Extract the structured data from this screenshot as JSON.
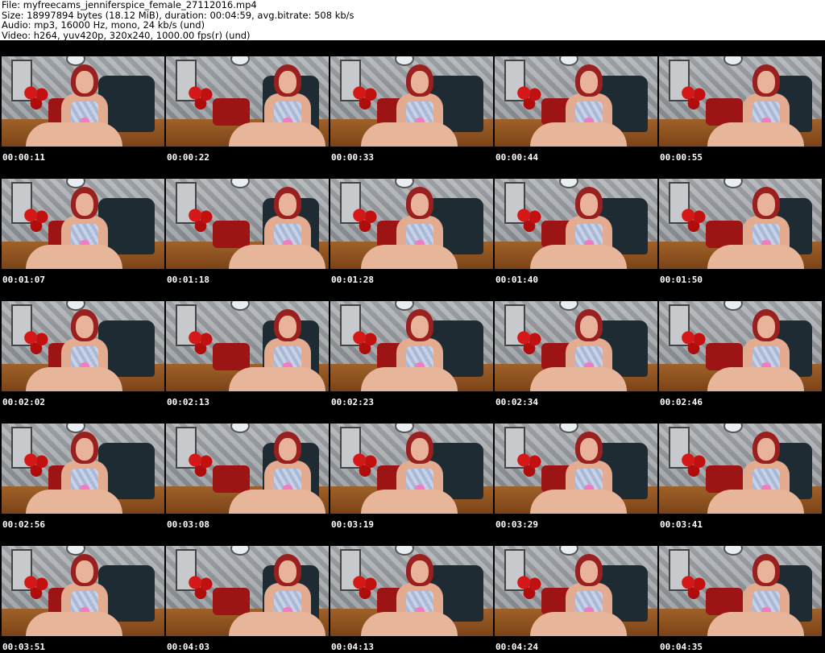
{
  "header": {
    "file_line": "File: myfreecams_jenniferspice_female_27112016.mp4",
    "size_line": "Size: 18997894 bytes (18.12 MiB), duration: 00:04:59, avg.bitrate: 508 kb/s",
    "audio_line": "Audio: mp3, 16000 Hz, mono, 24 kb/s (und)",
    "video_line": "Video: h264, yuv420p, 320x240, 1000.00 fps(r) (und)"
  },
  "thumbnails": [
    {
      "time": "00:00:11"
    },
    {
      "time": "00:00:22"
    },
    {
      "time": "00:00:33"
    },
    {
      "time": "00:00:44"
    },
    {
      "time": "00:00:55"
    },
    {
      "time": "00:01:07"
    },
    {
      "time": "00:01:18"
    },
    {
      "time": "00:01:28"
    },
    {
      "time": "00:01:40"
    },
    {
      "time": "00:01:50"
    },
    {
      "time": "00:02:02"
    },
    {
      "time": "00:02:13"
    },
    {
      "time": "00:02:23"
    },
    {
      "time": "00:02:34"
    },
    {
      "time": "00:02:46"
    },
    {
      "time": "00:02:56"
    },
    {
      "time": "00:03:08"
    },
    {
      "time": "00:03:19"
    },
    {
      "time": "00:03:29"
    },
    {
      "time": "00:03:41"
    },
    {
      "time": "00:03:51"
    },
    {
      "time": "00:04:03"
    },
    {
      "time": "00:04:13"
    },
    {
      "time": "00:04:24"
    },
    {
      "time": "00:04:35"
    }
  ]
}
